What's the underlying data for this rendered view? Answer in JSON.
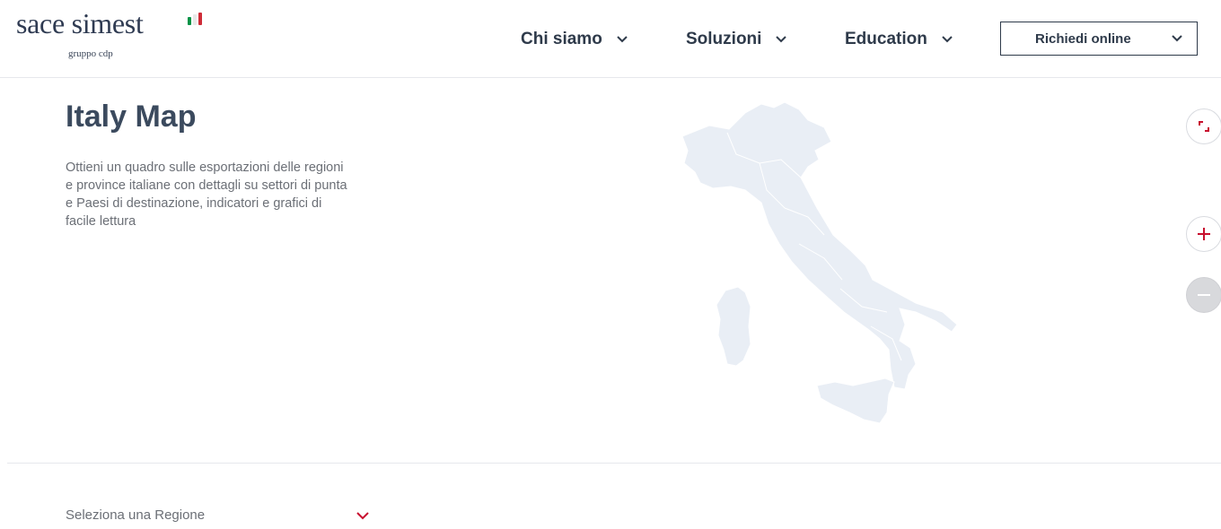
{
  "header": {
    "logo": {
      "main": "sace simest",
      "sub": "gruppo cdp"
    },
    "flag_colors": [
      "#009246",
      "#ffffff",
      "#ce2b37"
    ],
    "nav": [
      {
        "label": "Chi siamo"
      },
      {
        "label": "Soluzioni"
      },
      {
        "label": "Education"
      }
    ],
    "cta": {
      "label": "Richiedi online"
    }
  },
  "hero": {
    "title": "Italy Map",
    "description": "Ottieni un quadro sulle esportazioni delle regioni e province italiane con dettagli su settori di punta e Paesi di destinazione, indicatori e grafici di facile lettura"
  },
  "map_controls": {
    "fullscreen_icon": "expand-icon",
    "zoom_in_icon": "plus-icon",
    "zoom_out_icon": "minus-icon"
  },
  "region_select": {
    "placeholder": "Seleziona una Regione"
  },
  "colors": {
    "accent": "#c8102e",
    "text_dark": "#2e3a4a",
    "map_fill": "#e9eef5"
  }
}
